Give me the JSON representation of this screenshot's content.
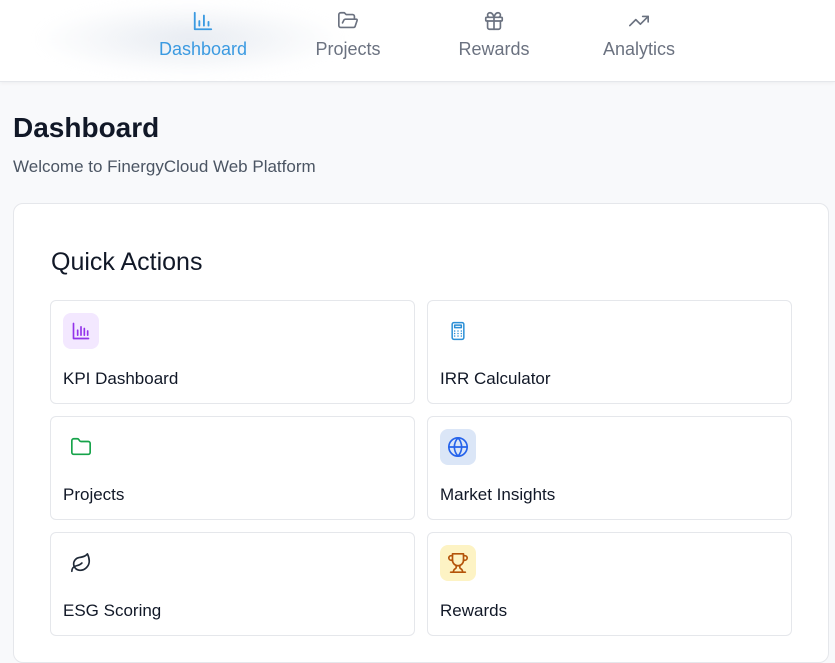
{
  "nav": {
    "tabs": [
      {
        "label": "Dashboard",
        "icon": "bar-chart-icon",
        "active": true
      },
      {
        "label": "Projects",
        "icon": "folder-open-icon",
        "active": false
      },
      {
        "label": "Rewards",
        "icon": "gift-icon",
        "active": false
      },
      {
        "label": "Analytics",
        "icon": "trending-up-icon",
        "active": false
      }
    ]
  },
  "header": {
    "title": "Dashboard",
    "subtitle": "Welcome to FinergyCloud Web Platform"
  },
  "quick_actions": {
    "title": "Quick Actions",
    "items": [
      {
        "label": "KPI Dashboard",
        "icon": "bar-chart-icon",
        "color": "#9333ea",
        "bg": "#f3e8ff"
      },
      {
        "label": "IRR Calculator",
        "icon": "calculator-icon",
        "color": "#2b8fd6",
        "bg": "#ffffff"
      },
      {
        "label": "Projects",
        "icon": "folder-icon",
        "color": "#16a34a",
        "bg": "#ffffff"
      },
      {
        "label": "Market Insights",
        "icon": "globe-icon",
        "color": "#2563eb",
        "bg": "#dbe6f7"
      },
      {
        "label": "ESG Scoring",
        "icon": "leaf-icon",
        "color": "#1f2937",
        "bg": "#ffffff"
      },
      {
        "label": "Rewards",
        "icon": "trophy-icon",
        "color": "#b45309",
        "bg": "#fdf3c4"
      }
    ]
  },
  "colors": {
    "accent": "#3b9ae1",
    "muted_text": "#6b7280",
    "border": "#e5e7eb"
  }
}
